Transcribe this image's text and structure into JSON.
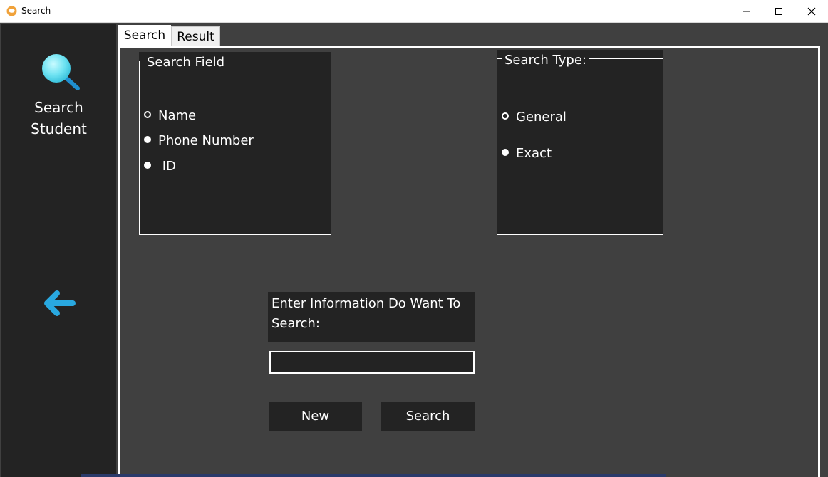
{
  "window": {
    "title": "Search"
  },
  "sidebar": {
    "nav_label_line1": "Search",
    "nav_label_line2": "Student",
    "search_icon": "magnifier-icon",
    "back_icon": "arrow-left-icon"
  },
  "tabs": [
    {
      "label": "Search",
      "selected": true
    },
    {
      "label": "Result",
      "selected": false
    }
  ],
  "search_field": {
    "legend": "Search Field",
    "options": [
      {
        "label": "Name",
        "checked": false
      },
      {
        "label": "Phone Number",
        "checked": true
      },
      {
        "label": " ID",
        "checked": true
      }
    ]
  },
  "search_type": {
    "legend": "Search Type:",
    "options": [
      {
        "label": "General",
        "checked": false
      },
      {
        "label": "Exact",
        "checked": true
      }
    ]
  },
  "prompt": {
    "line1": "Enter Information Do Want To",
    "line2": "Search:"
  },
  "search_input": {
    "value": "",
    "placeholder": ""
  },
  "buttons": {
    "new_label": "New",
    "search_label": "Search"
  },
  "colors": {
    "sidebar_bg": "#232323",
    "content_bg": "#404040",
    "accent_icon": "#29a8e0",
    "text": "#ffffff"
  }
}
